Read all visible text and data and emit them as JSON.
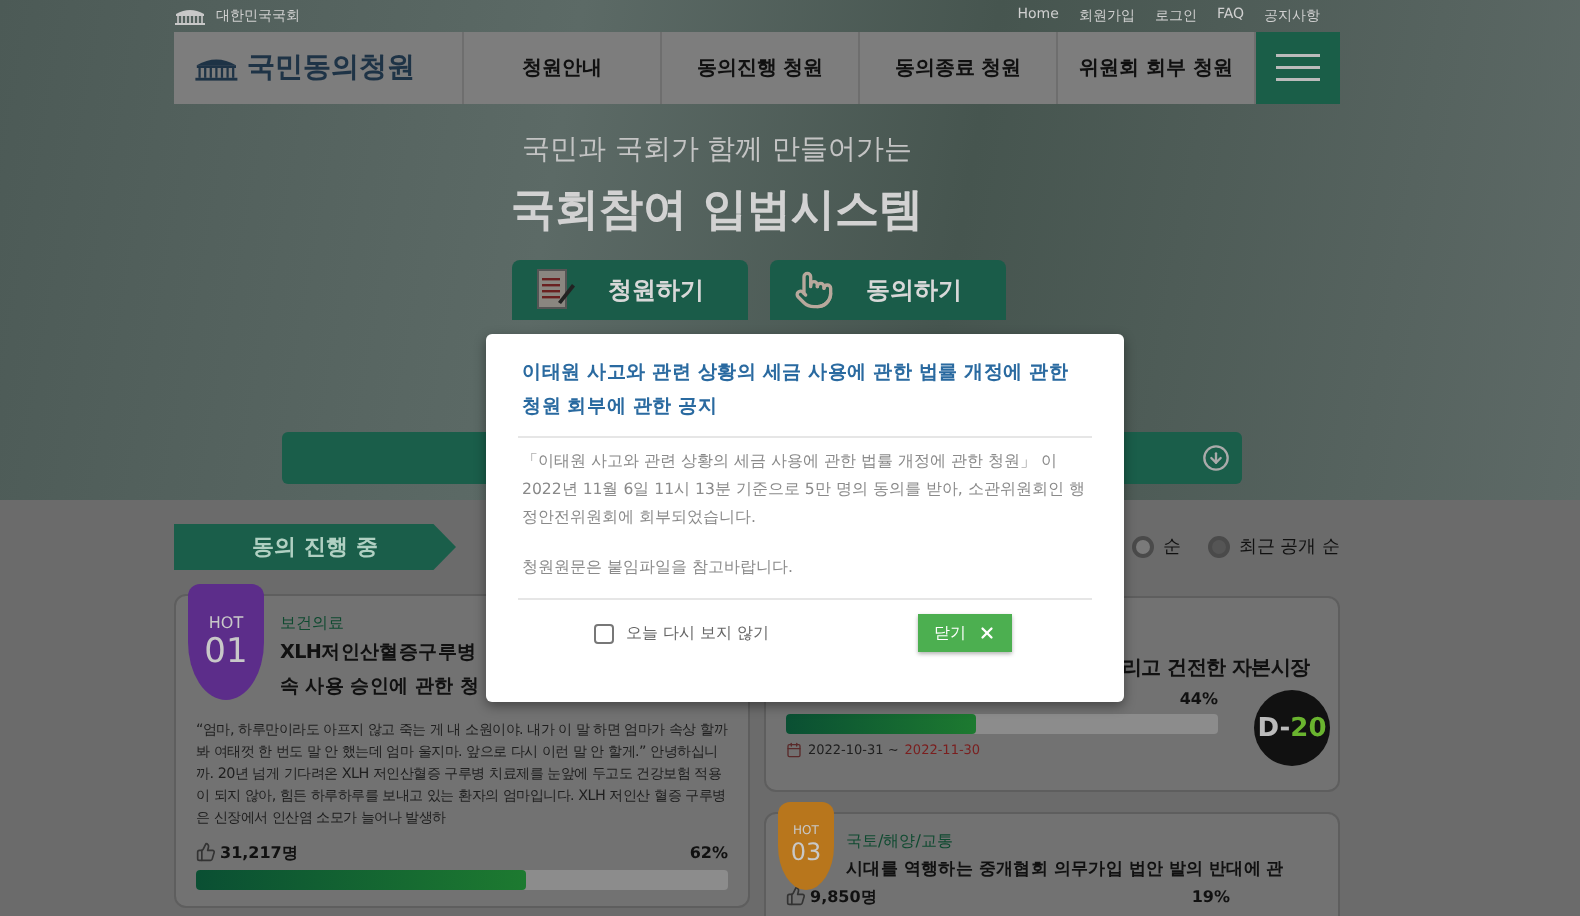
{
  "header": {
    "org_name": "대한민국국회",
    "links": [
      "Home",
      "회원가입",
      "로그인",
      "FAQ",
      "공지사항"
    ]
  },
  "nav": {
    "logo_text": "국민동의청원",
    "items": [
      "청원안내",
      "동의진행 청원",
      "동의종료 청원",
      "위원회 회부 청원"
    ]
  },
  "hero": {
    "subtitle": "국민과 국회가 함께 만들어가는",
    "title": "국회참여 입법시스템",
    "buttons": [
      {
        "label": "청원하기",
        "kind": "write"
      },
      {
        "label": "동의하기",
        "kind": "tap"
      }
    ]
  },
  "section": {
    "heading": "동의 진행 중",
    "sort_options": [
      {
        "label": "순",
        "selected": false
      },
      {
        "label": "최근 공개 순",
        "selected": true
      }
    ]
  },
  "left_column": [
    {
      "hot_label": "HOT",
      "rank": "01",
      "color": "#5c2d8a",
      "category": "보건의료",
      "title_lines": [
        "XLH저인산혈증구루병",
        "속 사용 승인에 관한 청"
      ],
      "excerpt": "“엄마, 하루만이라도 아프지 않고 죽는 게 내 소원이야. 내가 이 말 하면 엄마가 속상 할까봐 여태껏 한 번도 말 안 했는데 엄마 울지마. 앞으로 다시 이런 말 안 할게.” 안녕하십니까. 20년 넘게 기다려온 XLH 저인산혈증 구루병 치료제를 눈앞에 두고도 건강보험 적용이 되지 않아, 힘든 하루하루를 보내고 있는 환자의 엄마입니다. XLH 저인산 혈증 구루병은 신장에서 인산염 소모가 늘어나 발생하",
      "count": "31,217명",
      "percent": "62%",
      "level": 0.62
    }
  ],
  "right_column": [
    {
      "title_lines": [
        "리고 건전한 자본시장"
      ],
      "percent": "44%",
      "level": 0.44,
      "dates": {
        "start": "2022-10-31 ~",
        "end": "2022-11-30"
      },
      "d_day": {
        "prefix": "D-",
        "number": "20"
      }
    },
    {
      "hot_label": "HOT",
      "rank": "03",
      "color": "#b8761c",
      "category": "국토/해양/교통",
      "title_lines": [
        "시대를 역행하는 중개협회 의무가입 법안 발의 반대에 관"
      ],
      "count": "9,850명",
      "percent": "19%"
    }
  ],
  "modal": {
    "title": "이태원 사고와 관련 상황의 세금 사용에 관한 법률 개정에 관한 청원 회부에 관한 공지",
    "paragraphs": [
      "「이태원 사고와 관련 상황의 세금 사용에 관한 법률 개정에 관한 청원」 이 2022년 11월 6일 11시 13분 기준으로 5만 명의 동의를 받아, 소관위원회인 행정안전위원회에 회부되었습니다.",
      "청원원문은 붙임파일을 참고바랍니다."
    ],
    "dont_show_again": {
      "label": "오늘 다시 보지 않기",
      "checked": false
    },
    "close_button": "닫기"
  }
}
